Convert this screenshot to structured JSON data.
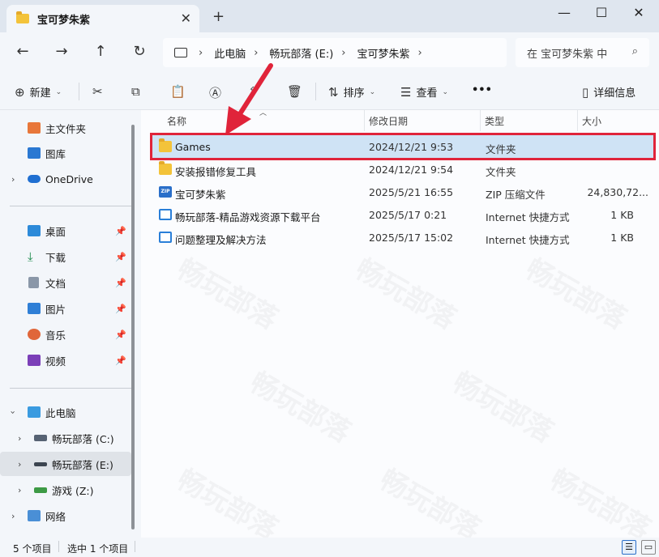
{
  "window": {
    "tab_title": "宝可梦朱紫",
    "tab_close": "✕",
    "new_tab": "+",
    "minimize": "—",
    "maximize": "☐",
    "close": "✕"
  },
  "nav": {
    "back": "←",
    "forward": "→",
    "up": "↑",
    "refresh": "↻"
  },
  "address": {
    "crumbs": [
      "此电脑",
      "畅玩部落 (E:)",
      "宝可梦朱紫"
    ],
    "separator": "›"
  },
  "search": {
    "placeholder": "在 宝可梦朱紫 中",
    "icon": "⌕"
  },
  "toolbar": {
    "new_label": "新建",
    "sort_label": "排序",
    "view_label": "查看",
    "more_label": "•••",
    "details_label": "详细信息"
  },
  "sidebar": {
    "items": [
      {
        "label": "主文件夹",
        "icon": "home-icon"
      },
      {
        "label": "图库",
        "icon": "gallery-icon"
      },
      {
        "label": "OneDrive",
        "icon": "cloud-icon"
      },
      {
        "label": "桌面",
        "icon": "desktop-icon"
      },
      {
        "label": "下载",
        "icon": "download-icon"
      },
      {
        "label": "文档",
        "icon": "document-icon"
      },
      {
        "label": "图片",
        "icon": "pictures-icon"
      },
      {
        "label": "音乐",
        "icon": "music-icon"
      },
      {
        "label": "视频",
        "icon": "video-icon"
      },
      {
        "label": "此电脑",
        "icon": "pc-icon"
      },
      {
        "label": "畅玩部落 (C:)",
        "icon": "drive-icon"
      },
      {
        "label": "畅玩部落 (E:)",
        "icon": "drive-icon"
      },
      {
        "label": "游戏 (Z:)",
        "icon": "drive-icon"
      },
      {
        "label": "网络",
        "icon": "network-icon"
      }
    ]
  },
  "columns": {
    "name": "名称",
    "modified": "修改日期",
    "type": "类型",
    "size": "大小"
  },
  "files": [
    {
      "name": "Games",
      "modified": "2024/12/21 9:53",
      "type": "文件夹",
      "size": "",
      "icon": "folder-icon"
    },
    {
      "name": "安装报错修复工具",
      "modified": "2024/12/21 9:54",
      "type": "文件夹",
      "size": "",
      "icon": "folder-icon"
    },
    {
      "name": "宝可梦朱紫",
      "modified": "2025/5/21 16:55",
      "type": "ZIP 压缩文件",
      "size": "24,830,72...",
      "icon": "zip-icon"
    },
    {
      "name": "畅玩部落-精品游戏资源下载平台",
      "modified": "2025/5/17 0:21",
      "type": "Internet 快捷方式",
      "size": "1 KB",
      "icon": "internet-shortcut-icon"
    },
    {
      "name": "问题整理及解决方法",
      "modified": "2025/5/17 15:02",
      "type": "Internet 快捷方式",
      "size": "1 KB",
      "icon": "internet-shortcut-icon"
    }
  ],
  "status": {
    "item_count": "5 个项目",
    "selected": "选中 1 个项目"
  },
  "watermark": "畅玩部落",
  "colors": {
    "highlight": "#e0243a",
    "selection": "#cfe3f5"
  }
}
